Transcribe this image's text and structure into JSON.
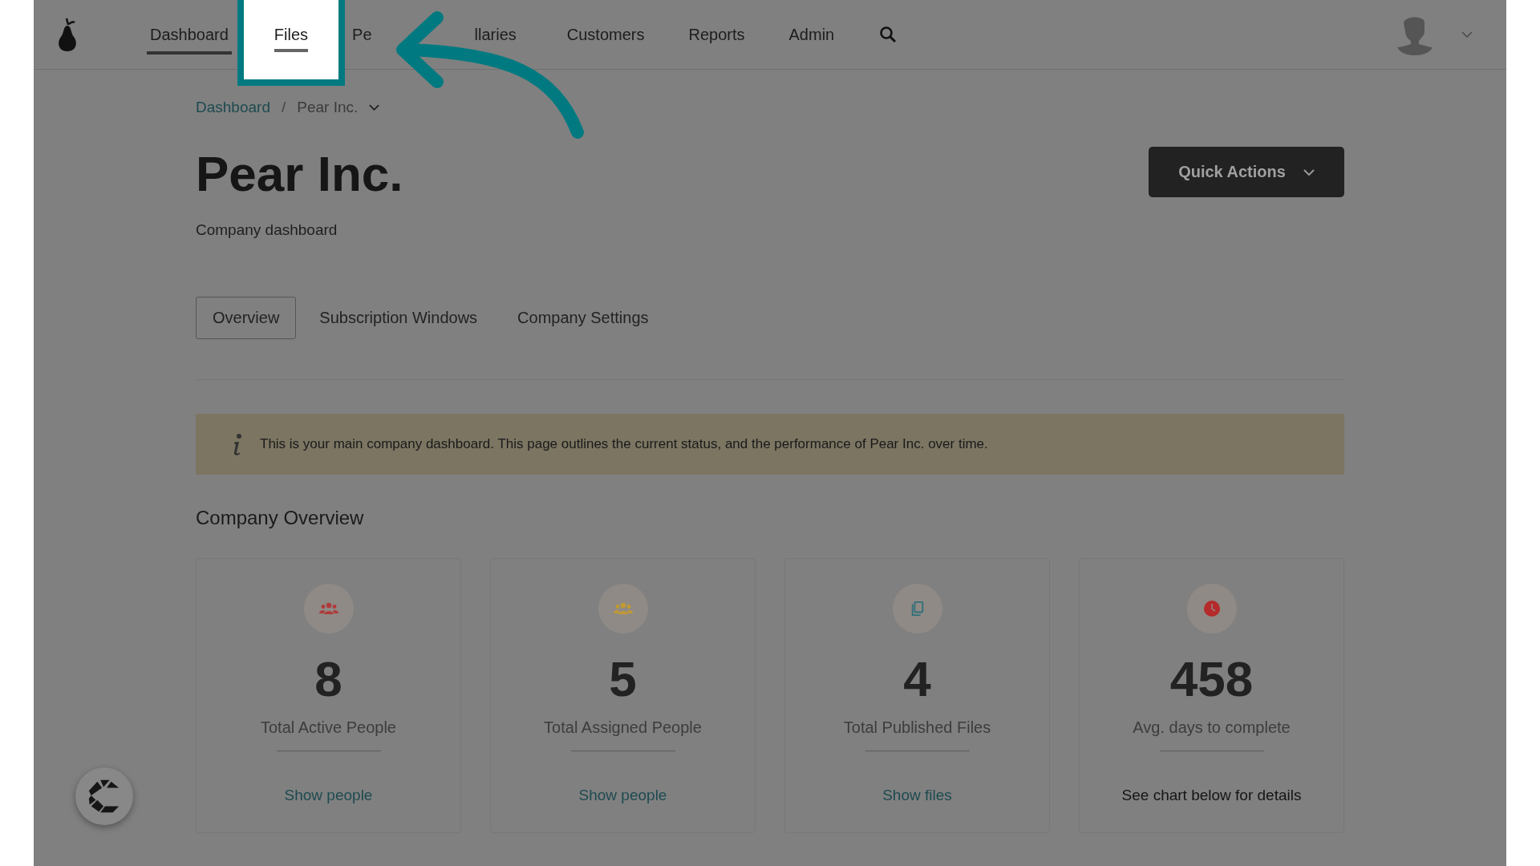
{
  "nav": {
    "items": [
      {
        "label": "Dashboard",
        "selected": true,
        "highlighted": false
      },
      {
        "label": "Files",
        "selected": false,
        "highlighted": true
      },
      {
        "label": "Pe",
        "selected": false,
        "highlighted": false
      },
      {
        "label": "llaries",
        "selected": false,
        "highlighted": false
      },
      {
        "label": "Customers",
        "selected": false,
        "highlighted": false
      },
      {
        "label": "Reports",
        "selected": false,
        "highlighted": false
      },
      {
        "label": "Admin",
        "selected": false,
        "highlighted": false
      }
    ]
  },
  "breadcrumb": [
    {
      "label": "Dashboard",
      "kind": "link"
    },
    {
      "label": "Pear Inc.",
      "kind": "dropdown"
    }
  ],
  "breadcrumb_separator": "/",
  "title": "Pear Inc.",
  "subtitle": "Company dashboard",
  "quick_actions": "Quick Actions",
  "tabs": [
    {
      "label": "Overview",
      "selected": true
    },
    {
      "label": "Subscription Windows",
      "selected": false
    },
    {
      "label": "Company Settings",
      "selected": false
    }
  ],
  "info": "This is your main company dashboard. This page outlines the current status, and the performance of Pear Inc. over time.",
  "section_title": "Company Overview",
  "cards": [
    {
      "kind": "people",
      "color": "#b03a3a",
      "value": "8",
      "label": "Total Active People",
      "action": "Show people",
      "action_is_link": true
    },
    {
      "kind": "people",
      "color": "#c29a30",
      "value": "5",
      "label": "Total Assigned People",
      "action": "Show people",
      "action_is_link": true
    },
    {
      "kind": "files",
      "color": "#2f6f78",
      "value": "4",
      "label": "Total Published Files",
      "action": "Show files",
      "action_is_link": true
    },
    {
      "kind": "clock",
      "color": "#b52a2a",
      "value": "458",
      "label": "Avg. days to complete",
      "action": "See chart below for details",
      "action_is_link": false
    }
  ]
}
